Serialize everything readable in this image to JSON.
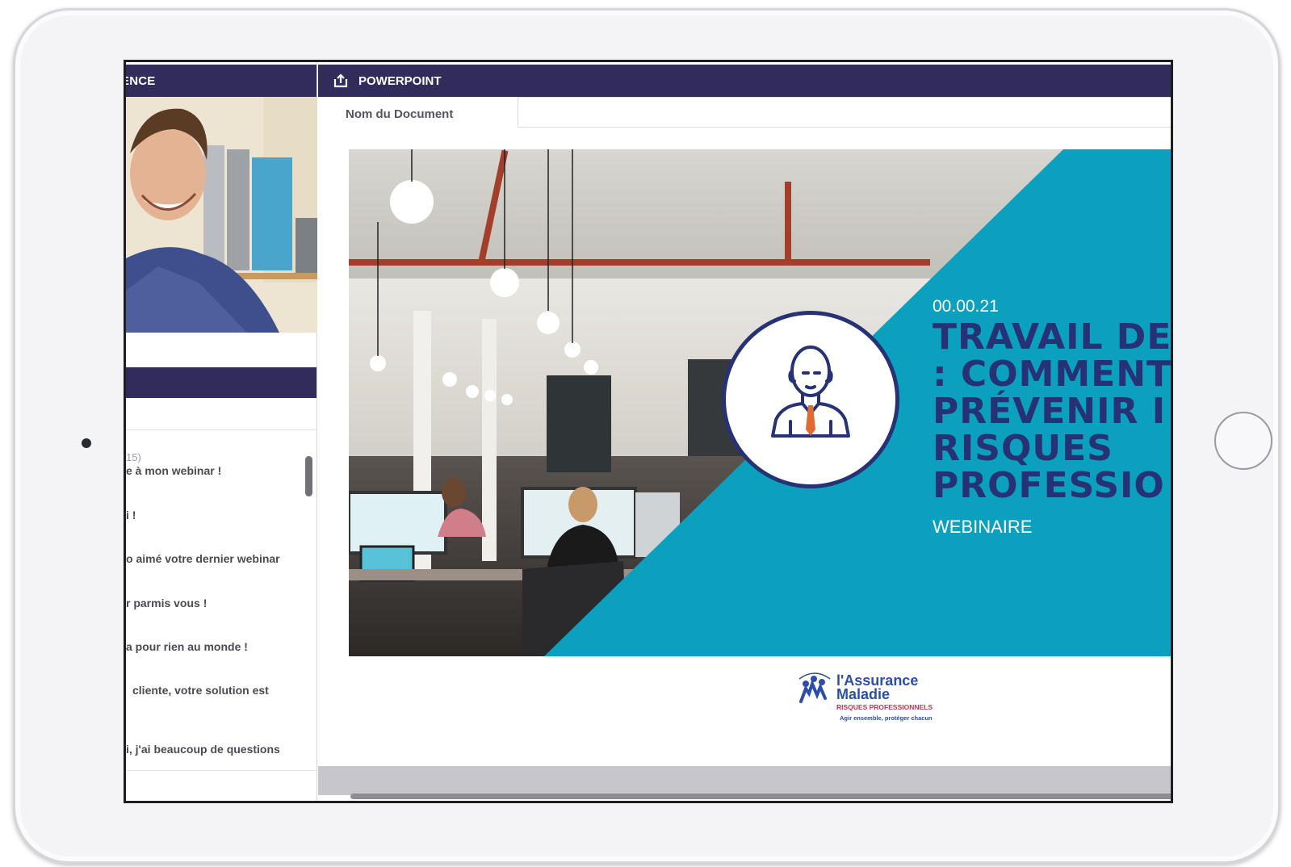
{
  "conference_panel": {
    "header_label": "ENCE"
  },
  "chat": {
    "meta": "15)",
    "messages": [
      "e à mon webinar !",
      "i !",
      "o aimé votre dernier webinar",
      "r parmis vous !",
      "a pour rien au monde !",
      "cliente, votre solution est",
      "i, j'ai beaucoup de questions"
    ]
  },
  "powerpoint": {
    "header_label": "POWERPOINT",
    "header_icon": "upload-icon",
    "document_name_label": "Nom du Document",
    "document_name_value": ""
  },
  "slide": {
    "date": "00.00.21",
    "title": "TRAVAIL DE\n: COMMENT\nPRÉVENIR I\nRISQUES\nPROFESSIO",
    "subtitle": "WEBINAIRE",
    "accent_color": "#0aa0be",
    "title_color": "#263275",
    "avatar_icon": "businessman-icon"
  },
  "logo": {
    "name": "l'Assurance\nMaladie",
    "sub": "RISQUES PROFESSIONNELS",
    "tagline": "Agir ensemble, protéger chacun"
  }
}
